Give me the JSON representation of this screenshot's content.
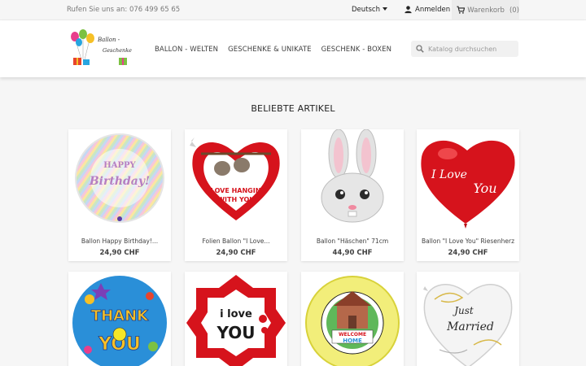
{
  "topbar": {
    "phone": "Rufen Sie uns an: 076 499 65 65",
    "language": "Deutsch",
    "signin": "Anmelden",
    "cart_label": "Warenkorb",
    "cart_count": "(0)"
  },
  "header": {
    "logo_line1": "Ballon -",
    "logo_line2": "Geschenke",
    "nav": [
      "BALLON - WELTEN",
      "GESCHENKE & UNIKATE",
      "GESCHENK - BOXEN"
    ],
    "search_placeholder": "Katalog durchsuchen"
  },
  "section": {
    "title": "BELIEBTE ARTIKEL"
  },
  "products": [
    {
      "name": "Ballon Happy Birthday!...",
      "price": "24,90 CHF",
      "art_text": "Happy Birthday!"
    },
    {
      "name": "Folien Ballon \"I Love...",
      "price": "24,90 CHF",
      "art_text": "I LOVE HANGING WITH YOU"
    },
    {
      "name": "Ballon \"Häschen\" 71cm",
      "price": "44,90 CHF",
      "art_text": ""
    },
    {
      "name": "Ballon \"I Love You\" Riesenherz",
      "price": "24,90 CHF",
      "art_text": "I Love You"
    },
    {
      "name": "",
      "price": "",
      "art_text": "THANK YOU"
    },
    {
      "name": "",
      "price": "",
      "art_text": "I love YOU"
    },
    {
      "name": "",
      "price": "",
      "art_text": "WELCOME HOME"
    },
    {
      "name": "",
      "price": "",
      "art_text": "Just Married"
    }
  ],
  "colors": {
    "accent": "#24b9d7",
    "heart_red": "#d6131c",
    "price_text": "#414141"
  }
}
